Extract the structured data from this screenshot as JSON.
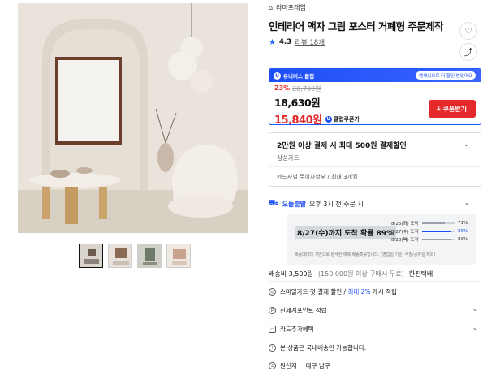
{
  "seller": {
    "name": "라마프레임"
  },
  "product": {
    "title": "인테리어 액자 그림 포스터 거폐형 주문제작",
    "rating": "4.3",
    "review_label": "리뷰 18개"
  },
  "price": {
    "club_banner": "유니버스 클럽",
    "club_banner_right": "쌤세싱으로 더 할인 받았어요",
    "discount_rate": "23%",
    "original": "20,700원",
    "sale": "18,630원",
    "club_price": "15,840원",
    "club_label": "클럽쿠폰가",
    "coupon_button": "쿠폰받기"
  },
  "card_benefit": {
    "line1": "2만원 이상 결제 시 최대 500원 결제할인",
    "card_name": "삼성카드",
    "installment": "카드사별 무이자할부 / 최대 3개월"
  },
  "delivery": {
    "badge": "오늘출발",
    "cutoff": "오후 3시 전 주문 시",
    "estimate": "8/27(수)까지 도착 확률 89%",
    "probabilities": [
      {
        "date": "8/26(화) 도착",
        "percent": "71%",
        "value": 0.71
      },
      {
        "date": "8/27(수) 도착",
        "percent": "89%",
        "value": 0.89
      },
      {
        "date": "8/28(목) 도착",
        "percent": "89%",
        "value": 0.89
      }
    ],
    "note": "배송데이터 기반으로 분석한 예측 배송확률입니다. (영업일 기준, 주말/공휴일 제외)",
    "fee": "배송비 3,500원",
    "free_condition": "(150,000원 이상 구매시 무료)",
    "carrier": "한진택배"
  },
  "benefits": [
    {
      "icon": "card-icon",
      "text": "스마일카드 첫 결제 할인 / ",
      "highlight": "최대 2%",
      "suffix": " 캐시 적립"
    },
    {
      "icon": "point-icon",
      "text": "신세계포인트 적립",
      "highlight": "",
      "suffix": ""
    },
    {
      "icon": "card-benefit-icon",
      "text": "카드추가혜택",
      "highlight": "",
      "suffix": ""
    },
    {
      "icon": "info-icon",
      "text": "본 상품은 국내배송만 가능합니다.",
      "highlight": "",
      "suffix": ""
    }
  ],
  "origin": {
    "label": "원산지",
    "value": "대구 남구"
  }
}
